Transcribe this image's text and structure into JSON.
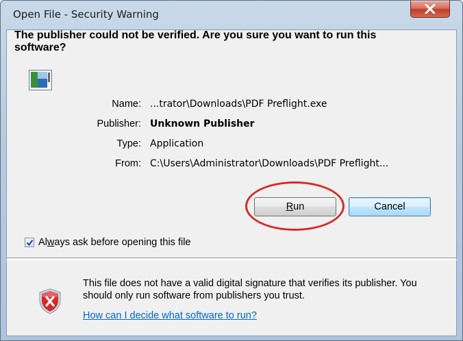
{
  "window": {
    "title": "Open File - Security Warning",
    "close_label": "X"
  },
  "heading": "The publisher could not be verified.  Are you sure you want to run this software?",
  "fields": [
    {
      "label": "Name:",
      "value": "...trator\\Downloads\\PDF Preflight.exe",
      "bold": false
    },
    {
      "label": "Publisher:",
      "value": "Unknown Publisher",
      "bold": true
    },
    {
      "label": "Type:",
      "value": "Application",
      "bold": false
    },
    {
      "label": "From:",
      "value": "C:\\Users\\Administrator\\Downloads\\PDF Preflight...",
      "bold": false
    }
  ],
  "buttons": {
    "run_label": "Run",
    "run_mnemonic": "R",
    "run_rest": "un",
    "cancel_label": "Cancel"
  },
  "checkbox": {
    "checked": true,
    "label": "Always ask before opening this file",
    "label_before": "Al",
    "label_mnemonic": "w",
    "label_after": "ays ask before opening this file"
  },
  "warning": {
    "text": "This file does not have a valid digital signature that verifies its publisher.  You should only run software from publishers you trust.",
    "link_text": "How can I decide what software to run?"
  },
  "icons": {
    "app": "application-icon",
    "shield": "security-shield-error-icon",
    "close": "close-icon"
  },
  "colors": {
    "accent_link": "#0066cc",
    "highlight_ellipse": "#d62a2a",
    "close_button": "#c0402a"
  }
}
